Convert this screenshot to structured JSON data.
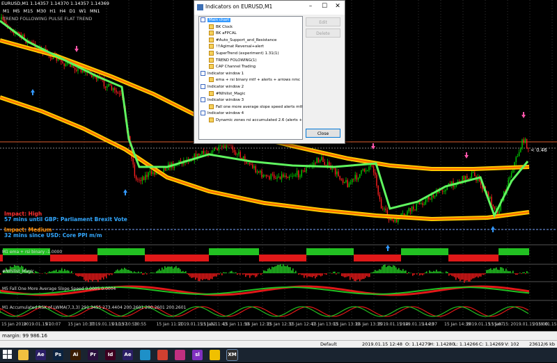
{
  "chart": {
    "header": "EURUSD,M1  1.14357 1.14370 1.14357 1.14369",
    "timeframes": [
      "M1",
      "M5",
      "M15",
      "M30",
      "H1",
      "H4",
      "D1",
      "W1",
      "MN1"
    ],
    "indicator_overlay": "TREND FOLLOWING PULSE FLAT TREND",
    "price_tag": "< 0.46",
    "news": [
      {
        "line1": "Impact: High",
        "line2": "57 mins until GBP: Parliament Brexit Vote"
      },
      {
        "line1": "Impact: Medium",
        "line2": "32 mins since USD: Core PPI m/m"
      }
    ],
    "panes": [
      "M1 ema + rsi binary -1.0000",
      "#NIhilist_Magic",
      "M5 Fall One More Average Slope Speed 0.0005 0.0004",
      "M1 Accumulated RSX of LWMA(7,3,3) 291.3455 273.4404 200.2601 200.2601 200.2601"
    ],
    "time_labels": [
      "15 Jan 2019",
      "2019.01.15 10:07",
      "07",
      "15 Jan 10:37",
      "2019.01.15 10:37",
      "01.15 10:53",
      "10:55",
      "15 Jan 11:11",
      "2019.01.15 11:32",
      "15 Jan 11:43",
      "15 Jan 11:59",
      "15 Jan 12:15",
      "15 Jan 12:31",
      "15 Jan 12:47",
      "15 Jan 13:03",
      "15 Jan 13:19",
      "15 Jan 13:35",
      "2019.01.15 14:",
      "2019.01.15 14:07",
      "14:23",
      "15 Jan 14:39",
      "2019.01.15 15:07",
      "15 Jan 15:",
      "2019.01.15 15:00",
      "2019.01.15 15:00"
    ],
    "colors": {
      "background": "#000000",
      "bull_candle": "#00cc00",
      "bear_candle": "#ff2020",
      "ma_band_outer": "#ffcc00",
      "ma_band_inner": "#ff7000",
      "ma_green": "#5ff55f",
      "level_line": "#e06030"
    }
  },
  "dialog": {
    "title": "Indicators on EURUSD,M1",
    "tree": [
      {
        "label": "Main chart",
        "type": "window",
        "level": 0,
        "selected": true
      },
      {
        "label": "BK Clock",
        "type": "indicator",
        "level": 1
      },
      {
        "label": "BK aFPCAL",
        "type": "indicator",
        "level": 1
      },
      {
        "label": "#Auto_Support_and_Resistance",
        "type": "indicator",
        "level": 1
      },
      {
        "label": "!!!Agimat Reversal+alert",
        "type": "indicator",
        "level": 1
      },
      {
        "label": "SuperTrend (experiment) 1.31(1)",
        "type": "indicator",
        "level": 1
      },
      {
        "label": "TREND FOLOWING(1)",
        "type": "indicator",
        "level": 1
      },
      {
        "label": "CAP Channel Trading",
        "type": "indicator",
        "level": 1
      },
      {
        "label": "Indicator window 1",
        "type": "window",
        "level": 0
      },
      {
        "label": "ema + rsi binary mtf + alerts + arrows nmc",
        "type": "indicator",
        "level": 1
      },
      {
        "label": "Indicator window 2",
        "type": "window",
        "level": 0
      },
      {
        "label": "#NIhilist_Magic",
        "type": "indicator",
        "level": 1
      },
      {
        "label": "Indicator window 3",
        "type": "window",
        "level": 0
      },
      {
        "label": "Fall one more average slope speed alerts mtf",
        "type": "indicator",
        "level": 1
      },
      {
        "label": "Indicator window 4",
        "type": "window",
        "level": 0
      },
      {
        "label": "Dynamic zones rsi accumulated 2.6 (alerts +",
        "type": "indicator",
        "level": 1
      }
    ],
    "buttons": {
      "edit": "Edit",
      "delete": "Delete",
      "close": "Close"
    },
    "window_controls": {
      "minimize": "–",
      "maximize": "☐",
      "close": "✕"
    }
  },
  "status": {
    "margin": "margin: 99 986.16",
    "profile": "Default",
    "datetime": "2019.01.15 12:48",
    "open": "O: 1.14279",
    "high": "H: 1.14280",
    "low": "L: 1.14266",
    "close": "C: 1.14269",
    "volume": "V: 102",
    "traffic": "23612/6 kb"
  },
  "taskbar": {
    "apps": [
      {
        "name": "file-explorer-icon",
        "label": "",
        "color": "#f0c040"
      },
      {
        "name": "after-effects-icon",
        "label": "Ae",
        "color": "#2b1f66"
      },
      {
        "name": "photoshop-icon",
        "label": "Ps",
        "color": "#0b2340"
      },
      {
        "name": "illustrator-icon",
        "label": "Ai",
        "color": "#3a1c00"
      },
      {
        "name": "premiere-icon",
        "label": "Pr",
        "color": "#2a0f3d"
      },
      {
        "name": "indesign-icon",
        "label": "Id",
        "color": "#3d0020"
      },
      {
        "name": "after-effects-2-icon",
        "label": "Ae",
        "color": "#2b1f66"
      },
      {
        "name": "app-circle-icon",
        "label": "",
        "color": "#1e90c8"
      },
      {
        "name": "chrome-icon",
        "label": "",
        "color": "#d04030"
      },
      {
        "name": "app-pink-icon",
        "label": "",
        "color": "#c03080"
      },
      {
        "name": "app-purple-icon",
        "label": "sl",
        "color": "#8030c0"
      },
      {
        "name": "norton-icon",
        "label": "",
        "color": "#f0c000"
      },
      {
        "name": "xm-terminal-icon",
        "label": "XM",
        "color": "#303030"
      }
    ]
  }
}
